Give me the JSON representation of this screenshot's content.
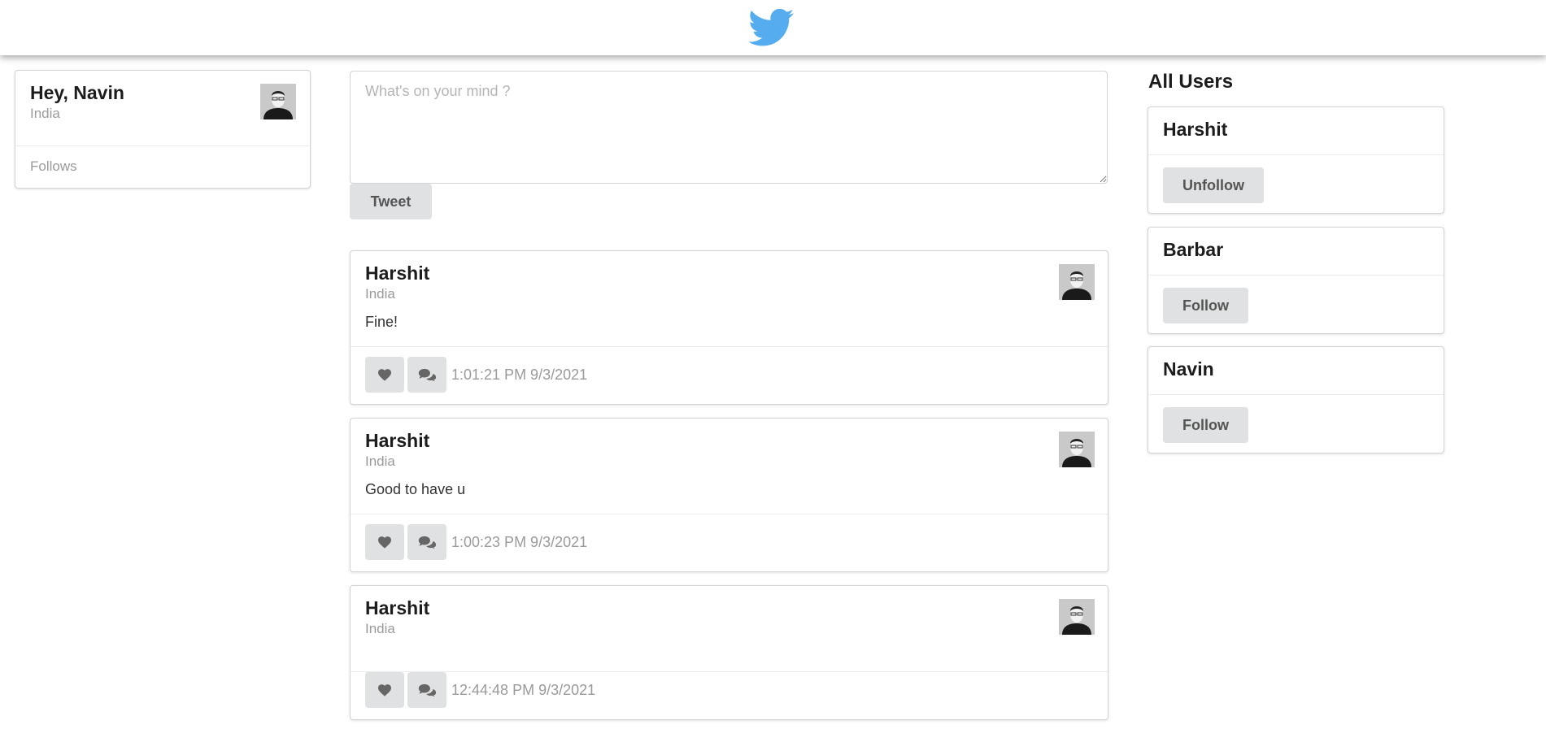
{
  "header": {
    "logo_icon": "twitter-bird-icon",
    "brand_color": "#55acee"
  },
  "profile": {
    "greeting": "Hey, Navin",
    "location": "India",
    "follows_label": "Follows"
  },
  "composer": {
    "placeholder": "What's on your mind ?",
    "value": "",
    "tweet_label": "Tweet"
  },
  "feed": [
    {
      "author": "Harshit",
      "location": "India",
      "text": "Fine!",
      "timestamp": "1:01:21 PM 9/3/2021"
    },
    {
      "author": "Harshit",
      "location": "India",
      "text": "Good to have u",
      "timestamp": "1:00:23 PM 9/3/2021"
    },
    {
      "author": "Harshit",
      "location": "India",
      "text": "",
      "timestamp": "12:44:48 PM 9/3/2021"
    }
  ],
  "users": {
    "title": "All Users",
    "items": [
      {
        "name": "Harshit",
        "action": "Unfollow"
      },
      {
        "name": "Barbar",
        "action": "Follow"
      },
      {
        "name": "Navin",
        "action": "Follow"
      }
    ]
  },
  "icons": {
    "like": "heart-icon",
    "comment": "comments-icon",
    "avatar": "user-avatar"
  }
}
